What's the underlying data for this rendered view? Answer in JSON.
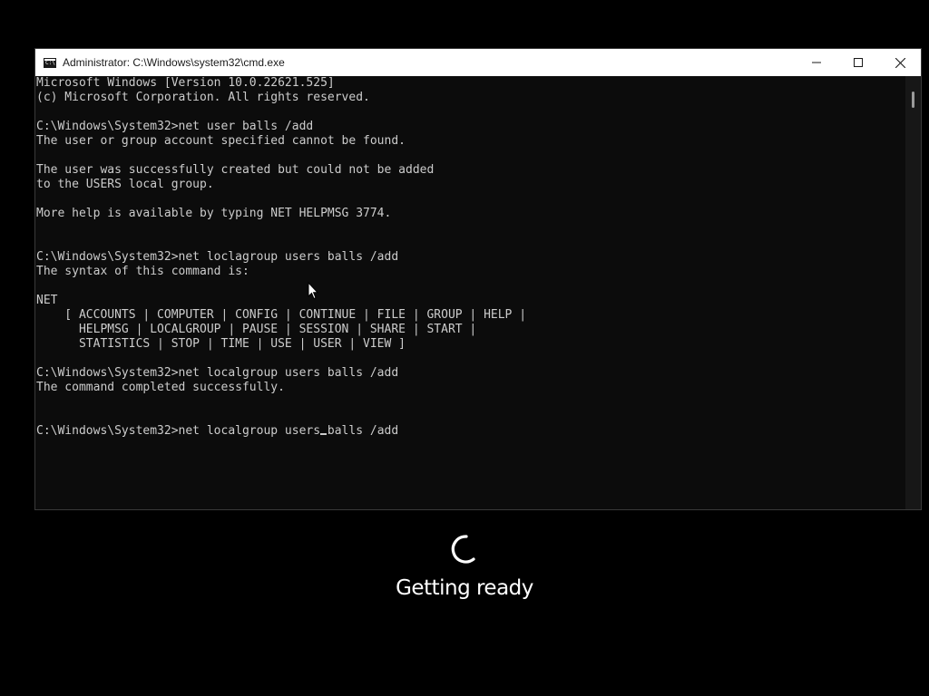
{
  "window": {
    "title": "Administrator: C:\\Windows\\system32\\cmd.exe",
    "icon": "cmd-icon",
    "controls": [
      "minimize-icon",
      "maximize-icon",
      "close-icon"
    ]
  },
  "console": {
    "lines": [
      "Microsoft Windows [Version 10.0.22621.525]",
      "(c) Microsoft Corporation. All rights reserved.",
      "",
      "C:\\Windows\\System32>net user balls /add",
      "The user or group account specified cannot be found.",
      "",
      "The user was successfully created but could not be added",
      "to the USERS local group.",
      "",
      "More help is available by typing NET HELPMSG 3774.",
      "",
      "",
      "C:\\Windows\\System32>net loclagroup users balls /add",
      "The syntax of this command is:",
      "",
      "NET",
      "    [ ACCOUNTS | COMPUTER | CONFIG | CONTINUE | FILE | GROUP | HELP |",
      "      HELPMSG | LOCALGROUP | PAUSE | SESSION | SHARE | START |",
      "      STATISTICS | STOP | TIME | USE | USER | VIEW ]",
      "",
      "C:\\Windows\\System32>net localgroup users balls /add",
      "The command completed successfully.",
      "",
      ""
    ],
    "prompt_before_caret": "C:\\Windows\\System32>net localgroup users",
    "prompt_after_caret": " balls /add",
    "text_color": "#cccccc",
    "background": "#0c0c0c"
  },
  "overlay": {
    "status_text": "Getting ready",
    "spinner_icon": "loading-spinner-icon"
  }
}
